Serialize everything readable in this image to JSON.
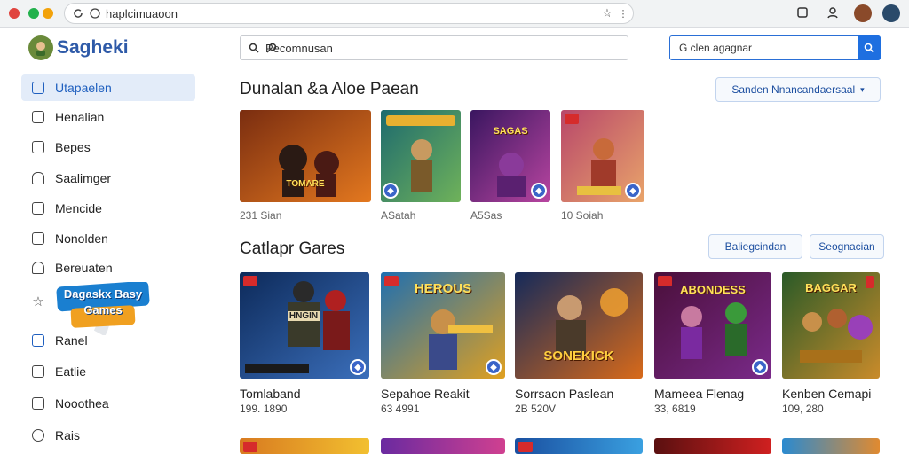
{
  "browser": {
    "url": "haplcimuaoon"
  },
  "brand": {
    "name": "Sagheki"
  },
  "search": {
    "placeholder": "Pecomnusan"
  },
  "search2": {
    "placeholder": "G clen agagnar"
  },
  "sidebar": {
    "items": [
      {
        "label": "Utapaelen",
        "icon": "bookmark-icon",
        "active": true
      },
      {
        "label": "Henalian",
        "icon": "list-icon"
      },
      {
        "label": "Bepes",
        "icon": "chat-icon"
      },
      {
        "label": "Saalimger",
        "icon": "bell-icon"
      },
      {
        "label": "Mencide",
        "icon": "window-icon"
      },
      {
        "label": "Nonolden",
        "icon": "document-icon"
      },
      {
        "label": "Bereuaten",
        "icon": "gem-icon"
      },
      {
        "label": "",
        "icon": "star-icon"
      },
      {
        "label": "Ranel",
        "icon": "controller-icon"
      },
      {
        "label": "Eatlie",
        "icon": "card-icon"
      },
      {
        "label": "Nooothea",
        "icon": "message-icon"
      },
      {
        "label": "Rais",
        "icon": "settings-icon"
      }
    ],
    "logo_text": "Dagaskx Basy Games"
  },
  "section1": {
    "title": "Dunalan &a Aloe Paean",
    "dropdown": "Sanden Nnancandaersaal",
    "cards": [
      {
        "caption": "231 Sian",
        "art_text": "TOMARE",
        "colors": [
          "#7a2d10",
          "#e3781f"
        ]
      },
      {
        "caption": "ASatah",
        "art_text": "",
        "colors": [
          "#1d6a6e",
          "#6fb25a"
        ]
      },
      {
        "caption": "A5Sas",
        "art_text": "SAGAS",
        "colors": [
          "#3a1660",
          "#b845a0"
        ]
      },
      {
        "caption": "10 Soiah",
        "art_text": "",
        "colors": [
          "#b8476a",
          "#e9a46a"
        ]
      }
    ]
  },
  "section2": {
    "title": "Catlapr Gares",
    "btn1": "Baliegcindan",
    "btn2": "Seognacian",
    "cards": [
      {
        "title": "Tomlaband",
        "price": "199. 1890",
        "art_text": "HNGIN",
        "colors": [
          "#0d2a5a",
          "#3b6fbb"
        ]
      },
      {
        "title": "Sepahoe Reakit",
        "price": "63 4991",
        "art_text": "HEROUS",
        "colors": [
          "#1f6fb0",
          "#e0a020"
        ]
      },
      {
        "title": "Sorrsaon Paslean",
        "price": "2B 520V",
        "art_text": "SONEKICK",
        "colors": [
          "#152a5a",
          "#d86a1a"
        ]
      },
      {
        "title": "Mameea Flenag",
        "price": "33, 6819",
        "art_text": "ABONDESS",
        "colors": [
          "#4a0f3a",
          "#7a2a8a"
        ]
      },
      {
        "title": "Kenben Cemapi",
        "price": "109, 280",
        "art_text": "BAGGAR",
        "colors": [
          "#2a5a28",
          "#c98b2a"
        ]
      }
    ]
  },
  "row3": {
    "cards": [
      {
        "colors": [
          "#d87a20",
          "#f2c030"
        ]
      },
      {
        "colors": [
          "#6a2aa0",
          "#d04090"
        ]
      },
      {
        "colors": [
          "#1a4fa0",
          "#3aa0e0"
        ]
      },
      {
        "colors": [
          "#5a1010",
          "#d02020"
        ]
      },
      {
        "colors": [
          "#2a8ad0",
          "#e08a30"
        ]
      }
    ]
  },
  "colors": {
    "accent": "#1e6fe0",
    "brand": "#2e5aa8",
    "active_bg": "#e3ecf9"
  }
}
